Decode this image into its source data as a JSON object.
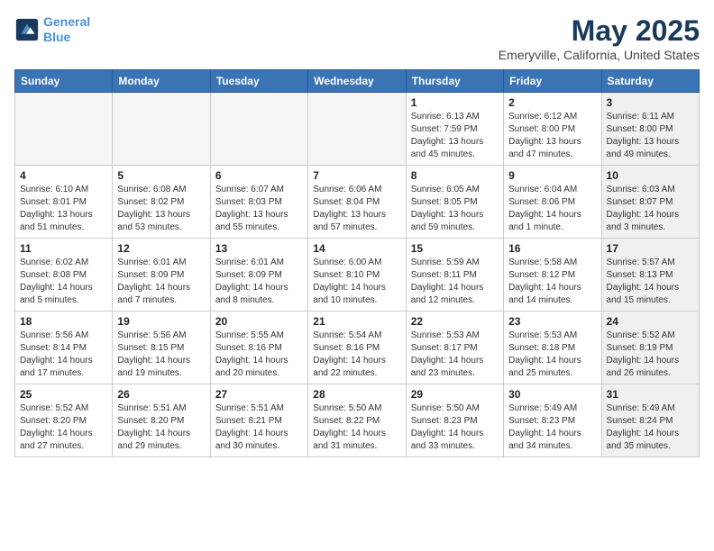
{
  "header": {
    "logo_line1": "General",
    "logo_line2": "Blue",
    "title": "May 2025",
    "subtitle": "Emeryville, California, United States"
  },
  "weekdays": [
    "Sunday",
    "Monday",
    "Tuesday",
    "Wednesday",
    "Thursday",
    "Friday",
    "Saturday"
  ],
  "weeks": [
    [
      {
        "day": "",
        "info": "",
        "empty": true
      },
      {
        "day": "",
        "info": "",
        "empty": true
      },
      {
        "day": "",
        "info": "",
        "empty": true
      },
      {
        "day": "",
        "info": "",
        "empty": true
      },
      {
        "day": "1",
        "info": "Sunrise: 6:13 AM\nSunset: 7:59 PM\nDaylight: 13 hours\nand 45 minutes.",
        "empty": false
      },
      {
        "day": "2",
        "info": "Sunrise: 6:12 AM\nSunset: 8:00 PM\nDaylight: 13 hours\nand 47 minutes.",
        "empty": false
      },
      {
        "day": "3",
        "info": "Sunrise: 6:11 AM\nSunset: 8:00 PM\nDaylight: 13 hours\nand 49 minutes.",
        "empty": false,
        "shaded": true
      }
    ],
    [
      {
        "day": "4",
        "info": "Sunrise: 6:10 AM\nSunset: 8:01 PM\nDaylight: 13 hours\nand 51 minutes.",
        "empty": false
      },
      {
        "day": "5",
        "info": "Sunrise: 6:08 AM\nSunset: 8:02 PM\nDaylight: 13 hours\nand 53 minutes.",
        "empty": false
      },
      {
        "day": "6",
        "info": "Sunrise: 6:07 AM\nSunset: 8:03 PM\nDaylight: 13 hours\nand 55 minutes.",
        "empty": false
      },
      {
        "day": "7",
        "info": "Sunrise: 6:06 AM\nSunset: 8:04 PM\nDaylight: 13 hours\nand 57 minutes.",
        "empty": false
      },
      {
        "day": "8",
        "info": "Sunrise: 6:05 AM\nSunset: 8:05 PM\nDaylight: 13 hours\nand 59 minutes.",
        "empty": false
      },
      {
        "day": "9",
        "info": "Sunrise: 6:04 AM\nSunset: 8:06 PM\nDaylight: 14 hours\nand 1 minute.",
        "empty": false
      },
      {
        "day": "10",
        "info": "Sunrise: 6:03 AM\nSunset: 8:07 PM\nDaylight: 14 hours\nand 3 minutes.",
        "empty": false,
        "shaded": true
      }
    ],
    [
      {
        "day": "11",
        "info": "Sunrise: 6:02 AM\nSunset: 8:08 PM\nDaylight: 14 hours\nand 5 minutes.",
        "empty": false
      },
      {
        "day": "12",
        "info": "Sunrise: 6:01 AM\nSunset: 8:09 PM\nDaylight: 14 hours\nand 7 minutes.",
        "empty": false
      },
      {
        "day": "13",
        "info": "Sunrise: 6:01 AM\nSunset: 8:09 PM\nDaylight: 14 hours\nand 8 minutes.",
        "empty": false
      },
      {
        "day": "14",
        "info": "Sunrise: 6:00 AM\nSunset: 8:10 PM\nDaylight: 14 hours\nand 10 minutes.",
        "empty": false
      },
      {
        "day": "15",
        "info": "Sunrise: 5:59 AM\nSunset: 8:11 PM\nDaylight: 14 hours\nand 12 minutes.",
        "empty": false
      },
      {
        "day": "16",
        "info": "Sunrise: 5:58 AM\nSunset: 8:12 PM\nDaylight: 14 hours\nand 14 minutes.",
        "empty": false
      },
      {
        "day": "17",
        "info": "Sunrise: 5:57 AM\nSunset: 8:13 PM\nDaylight: 14 hours\nand 15 minutes.",
        "empty": false,
        "shaded": true
      }
    ],
    [
      {
        "day": "18",
        "info": "Sunrise: 5:56 AM\nSunset: 8:14 PM\nDaylight: 14 hours\nand 17 minutes.",
        "empty": false
      },
      {
        "day": "19",
        "info": "Sunrise: 5:56 AM\nSunset: 8:15 PM\nDaylight: 14 hours\nand 19 minutes.",
        "empty": false
      },
      {
        "day": "20",
        "info": "Sunrise: 5:55 AM\nSunset: 8:16 PM\nDaylight: 14 hours\nand 20 minutes.",
        "empty": false
      },
      {
        "day": "21",
        "info": "Sunrise: 5:54 AM\nSunset: 8:16 PM\nDaylight: 14 hours\nand 22 minutes.",
        "empty": false
      },
      {
        "day": "22",
        "info": "Sunrise: 5:53 AM\nSunset: 8:17 PM\nDaylight: 14 hours\nand 23 minutes.",
        "empty": false
      },
      {
        "day": "23",
        "info": "Sunrise: 5:53 AM\nSunset: 8:18 PM\nDaylight: 14 hours\nand 25 minutes.",
        "empty": false
      },
      {
        "day": "24",
        "info": "Sunrise: 5:52 AM\nSunset: 8:19 PM\nDaylight: 14 hours\nand 26 minutes.",
        "empty": false,
        "shaded": true
      }
    ],
    [
      {
        "day": "25",
        "info": "Sunrise: 5:52 AM\nSunset: 8:20 PM\nDaylight: 14 hours\nand 27 minutes.",
        "empty": false
      },
      {
        "day": "26",
        "info": "Sunrise: 5:51 AM\nSunset: 8:20 PM\nDaylight: 14 hours\nand 29 minutes.",
        "empty": false
      },
      {
        "day": "27",
        "info": "Sunrise: 5:51 AM\nSunset: 8:21 PM\nDaylight: 14 hours\nand 30 minutes.",
        "empty": false
      },
      {
        "day": "28",
        "info": "Sunrise: 5:50 AM\nSunset: 8:22 PM\nDaylight: 14 hours\nand 31 minutes.",
        "empty": false
      },
      {
        "day": "29",
        "info": "Sunrise: 5:50 AM\nSunset: 8:23 PM\nDaylight: 14 hours\nand 33 minutes.",
        "empty": false
      },
      {
        "day": "30",
        "info": "Sunrise: 5:49 AM\nSunset: 8:23 PM\nDaylight: 14 hours\nand 34 minutes.",
        "empty": false
      },
      {
        "day": "31",
        "info": "Sunrise: 5:49 AM\nSunset: 8:24 PM\nDaylight: 14 hours\nand 35 minutes.",
        "empty": false,
        "shaded": true
      }
    ]
  ]
}
